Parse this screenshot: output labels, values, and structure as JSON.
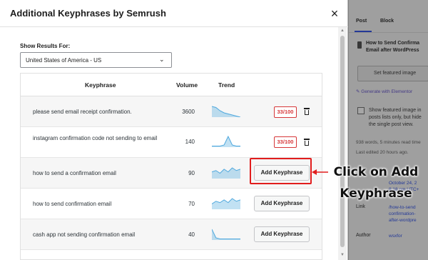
{
  "background": {
    "tabs": [
      "Post",
      "Block"
    ],
    "post_title": [
      "How to Send Confirma",
      "Email after WordPress"
    ],
    "featured_button": "Set featured image",
    "elementor": "Generate with Elementor",
    "checkbox_text": [
      "Show featured image in",
      "posts lists only, but hide",
      "the single post view."
    ],
    "word_count": "938 words, 5 minutes read time",
    "last_edited": "Last edited 20 hours ago.",
    "publish_date": [
      "October 24, 2",
      "8:18 pm UTC+"
    ],
    "link_label": "Link",
    "link_value": [
      "/how-to-send",
      "confirmation-",
      "after-wordpre"
    ],
    "author_label": "Author",
    "author_value": "wsxfor"
  },
  "modal": {
    "title": "Additional Keyphrases by Semrush",
    "close_label": "×",
    "results_label": "Show Results For:",
    "country": "United States of America - US",
    "table": {
      "headers": {
        "keyphrase": "Keyphrase",
        "volume": "Volume",
        "trend": "Trend"
      },
      "rows": [
        {
          "keyphrase": "please send email receipt confirmation.",
          "volume": "3600",
          "action": "score",
          "score": "33/100",
          "trend": [
            10,
            9,
            6,
            4,
            3,
            2,
            1,
            0
          ]
        },
        {
          "keyphrase": "instagram confirmation code not sending to email",
          "volume": "140",
          "action": "score",
          "score": "33/100",
          "trend": [
            1,
            1,
            1,
            2,
            10,
            2,
            1,
            1
          ]
        },
        {
          "keyphrase": "how to send a confirmation email",
          "volume": "90",
          "action": "add",
          "button": "Add Keyphrase",
          "trend": [
            5,
            6,
            4,
            7,
            5,
            8,
            6,
            7
          ]
        },
        {
          "keyphrase": "how to send confirmation email",
          "volume": "70",
          "action": "add",
          "button": "Add Keyphrase",
          "trend": [
            4,
            6,
            5,
            7,
            5,
            8,
            6,
            7
          ]
        },
        {
          "keyphrase": "cash app not sending confirmation email",
          "volume": "40",
          "action": "add",
          "button": "Add Keyphrase",
          "trend": [
            10,
            2,
            1,
            1,
            1,
            1,
            1,
            1
          ]
        }
      ]
    }
  },
  "annotation": {
    "line1": "Click on Add",
    "line2": "Keyphrase"
  },
  "colors": {
    "score_red": "#d63638",
    "trend_blue": "#4ea8de",
    "highlight_red": "#e11d1d"
  }
}
